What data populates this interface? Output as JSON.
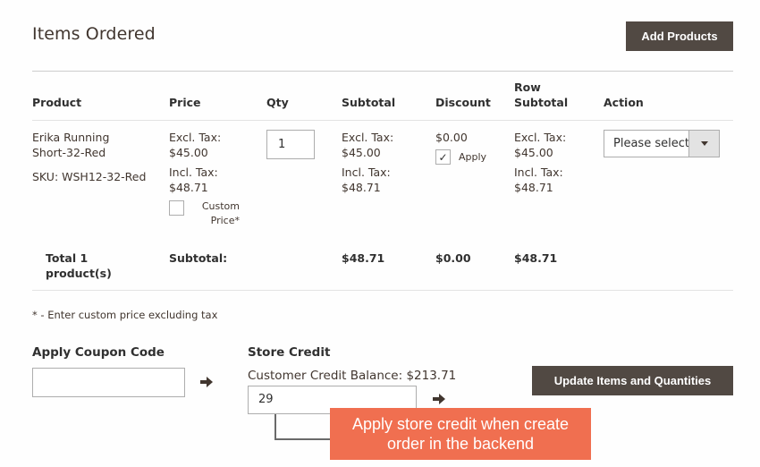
{
  "header": {
    "title": "Items Ordered",
    "add_products_label": "Add Products"
  },
  "table": {
    "columns": [
      "Product",
      "Price",
      "Qty",
      "Subtotal",
      "Discount",
      "Row",
      "Subtotal",
      "Action"
    ],
    "headers": {
      "product": "Product",
      "price": "Price",
      "qty": "Qty",
      "subtotal": "Subtotal",
      "discount": "Discount",
      "row_subtotal_line1": "Row",
      "row_subtotal_line2": "Subtotal",
      "action": "Action"
    },
    "rows": [
      {
        "product_name_line1": "Erika Running",
        "product_name_line2": "Short-32-Red",
        "sku": "SKU: WSH12-32-Red",
        "price_excl_label": "Excl. Tax:",
        "price_excl": "$45.00",
        "price_incl_label": "Incl. Tax:",
        "price_incl": "$48.71",
        "custom_price_label_line1": "Custom",
        "custom_price_label_line2": "Price*",
        "custom_price_checked": false,
        "qty": "1",
        "subtotal_excl_label": "Excl. Tax:",
        "subtotal_excl": "$45.00",
        "subtotal_incl_label": "Incl. Tax:",
        "subtotal_incl": "$48.71",
        "discount": "$0.00",
        "discount_apply_label": "Apply",
        "discount_apply_checked": true,
        "row_excl_label": "Excl. Tax:",
        "row_excl": "$45.00",
        "row_incl_label": "Incl. Tax:",
        "row_incl": "$48.71",
        "action_selected": "Please select"
      }
    ],
    "footer": {
      "total_line1": "Total 1",
      "total_line2": "product(s)",
      "subtotal_label": "Subtotal:",
      "subtotal": "$48.71",
      "discount": "$0.00",
      "row_subtotal": "$48.71"
    }
  },
  "note": "* - Enter custom price excluding tax",
  "coupon": {
    "label": "Apply Coupon Code",
    "value": "",
    "placeholder": ""
  },
  "store_credit": {
    "label": "Store Credit",
    "balance_text": "Customer Credit Balance: $213.71",
    "value": "29"
  },
  "update_button_label": "Update Items and Quantities",
  "callout": {
    "text": "Apply store credit when create order in the backend",
    "color": "#f06f50"
  },
  "colors": {
    "button_bg": "#514943",
    "text": "#41362f"
  }
}
